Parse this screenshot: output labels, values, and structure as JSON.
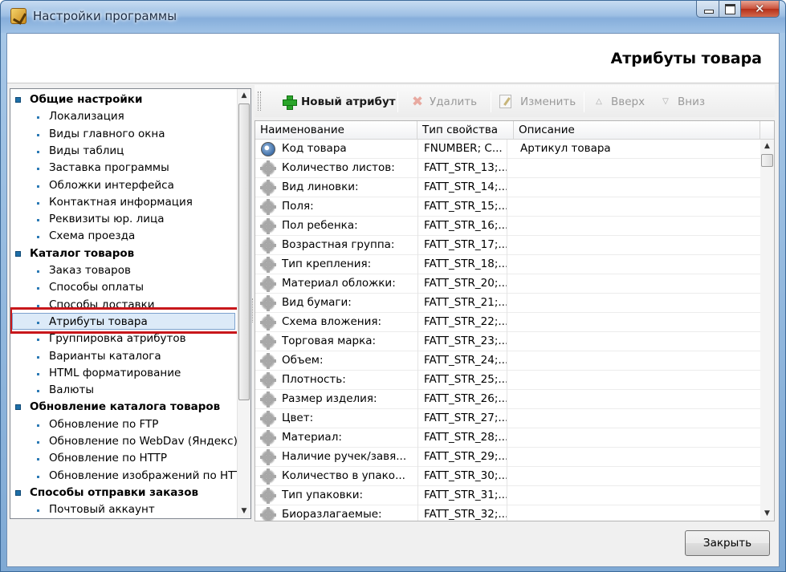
{
  "window": {
    "title": "Настройки программы",
    "icon": "app-logo-icon"
  },
  "header": {
    "title": "Атрибуты товара"
  },
  "tree": {
    "items": [
      {
        "type": "category",
        "label": "Общие настройки"
      },
      {
        "type": "item",
        "label": "Локализация"
      },
      {
        "type": "item",
        "label": "Виды главного окна"
      },
      {
        "type": "item",
        "label": "Виды таблиц"
      },
      {
        "type": "item",
        "label": "Заставка программы"
      },
      {
        "type": "item",
        "label": "Обложки интерфейса"
      },
      {
        "type": "item",
        "label": "Контактная информация"
      },
      {
        "type": "item",
        "label": "Реквизиты юр. лица"
      },
      {
        "type": "item",
        "label": "Схема проезда"
      },
      {
        "type": "category",
        "label": "Каталог товаров"
      },
      {
        "type": "item",
        "label": "Заказ товаров"
      },
      {
        "type": "item",
        "label": "Способы оплаты"
      },
      {
        "type": "item",
        "label": "Способы доставки"
      },
      {
        "type": "item",
        "label": "Атрибуты товара",
        "selected": true
      },
      {
        "type": "item",
        "label": "Группировка атрибутов"
      },
      {
        "type": "item",
        "label": "Варианты каталога"
      },
      {
        "type": "item",
        "label": "HTML форматирование"
      },
      {
        "type": "item",
        "label": "Валюты"
      },
      {
        "type": "category",
        "label": "Обновление каталога товаров"
      },
      {
        "type": "item",
        "label": "Обновление по FTP"
      },
      {
        "type": "item",
        "label": "Обновление по WebDav (Яндекс)"
      },
      {
        "type": "item",
        "label": "Обновление по HTTP"
      },
      {
        "type": "item",
        "label": "Обновление изображений по HTTP"
      },
      {
        "type": "category",
        "label": "Способы отправки заказов"
      },
      {
        "type": "item",
        "label": "Почтовый аккаунт"
      }
    ],
    "highlight_color": "#c8171b"
  },
  "toolbar": {
    "new": "Новый атрибут",
    "delete": "Удалить",
    "edit": "Изменить",
    "up": "Вверх",
    "down": "Вниз"
  },
  "grid": {
    "columns": [
      "Наименование",
      "Тип свойства",
      "Описание"
    ],
    "rows": [
      {
        "name": "Код товара",
        "type": "FNUMBER; C...",
        "desc": "Артикул товара",
        "icon": "key-icon"
      },
      {
        "name": "Количество листов:",
        "type": "FATT_STR_13;...",
        "desc": "",
        "icon": "gear-icon"
      },
      {
        "name": "Вид линовки:",
        "type": "FATT_STR_14;...",
        "desc": "",
        "icon": "gear-icon"
      },
      {
        "name": "Поля:",
        "type": "FATT_STR_15;...",
        "desc": "",
        "icon": "gear-icon"
      },
      {
        "name": "Пол ребенка:",
        "type": "FATT_STR_16;...",
        "desc": "",
        "icon": "gear-icon"
      },
      {
        "name": "Возрастная группа:",
        "type": "FATT_STR_17;...",
        "desc": "",
        "icon": "gear-icon"
      },
      {
        "name": "Тип крепления:",
        "type": "FATT_STR_18;...",
        "desc": "",
        "icon": "gear-icon"
      },
      {
        "name": "Материал обложки:",
        "type": "FATT_STR_20;...",
        "desc": "",
        "icon": "gear-icon"
      },
      {
        "name": "Вид бумаги:",
        "type": "FATT_STR_21;...",
        "desc": "",
        "icon": "gear-icon"
      },
      {
        "name": "Схема вложения:",
        "type": "FATT_STR_22;...",
        "desc": "",
        "icon": "gear-icon"
      },
      {
        "name": "Торговая марка:",
        "type": "FATT_STR_23;...",
        "desc": "",
        "icon": "gear-icon"
      },
      {
        "name": "Объем:",
        "type": "FATT_STR_24;...",
        "desc": "",
        "icon": "gear-icon"
      },
      {
        "name": "Плотность:",
        "type": "FATT_STR_25;...",
        "desc": "",
        "icon": "gear-icon"
      },
      {
        "name": "Размер изделия:",
        "type": "FATT_STR_26;...",
        "desc": "",
        "icon": "gear-icon"
      },
      {
        "name": "Цвет:",
        "type": "FATT_STR_27;...",
        "desc": "",
        "icon": "gear-icon"
      },
      {
        "name": "Материал:",
        "type": "FATT_STR_28;...",
        "desc": "",
        "icon": "gear-icon"
      },
      {
        "name": "Наличие ручек/завя...",
        "type": "FATT_STR_29;...",
        "desc": "",
        "icon": "gear-icon"
      },
      {
        "name": "Количество в упако...",
        "type": "FATT_STR_30;...",
        "desc": "",
        "icon": "gear-icon"
      },
      {
        "name": "Тип упаковки:",
        "type": "FATT_STR_31;...",
        "desc": "",
        "icon": "gear-icon"
      },
      {
        "name": "Биоразлагаемые:",
        "type": "FATT_STR_32;...",
        "desc": "",
        "icon": "gear-icon"
      }
    ]
  },
  "footer": {
    "close": "Закрыть"
  }
}
